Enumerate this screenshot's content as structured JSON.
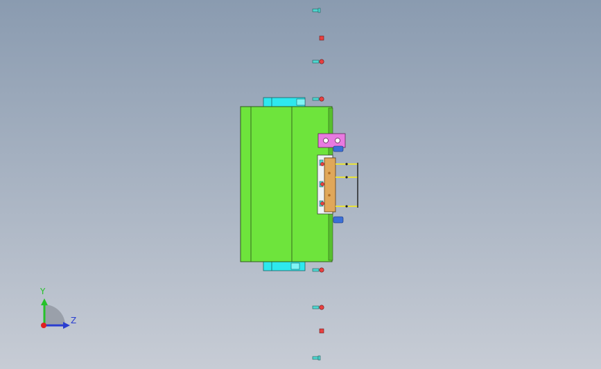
{
  "viewport": {
    "background_top": "#8a9bb0",
    "background_bottom": "#c7ccd5"
  },
  "colors": {
    "mold_plate": "#6ee43c",
    "mold_outline": "#2f5a1b",
    "guide_block": "#2ee8ee",
    "clamp_plate": "#e87ae0",
    "slider_orange": "#e0a75a",
    "ejector_pin": "#e8e23a",
    "screw_blue": "#3b6fd6",
    "bolt_head_red": "#e84040",
    "bolt_shank": "#4fd6d0",
    "axis_y": "#26c22a",
    "axis_z": "#2a3ed0",
    "axis_origin": "#e02020",
    "axis_arc": "#9aa0aa"
  },
  "axis_indicator": {
    "y_label": "Y",
    "z_label": "Z"
  }
}
